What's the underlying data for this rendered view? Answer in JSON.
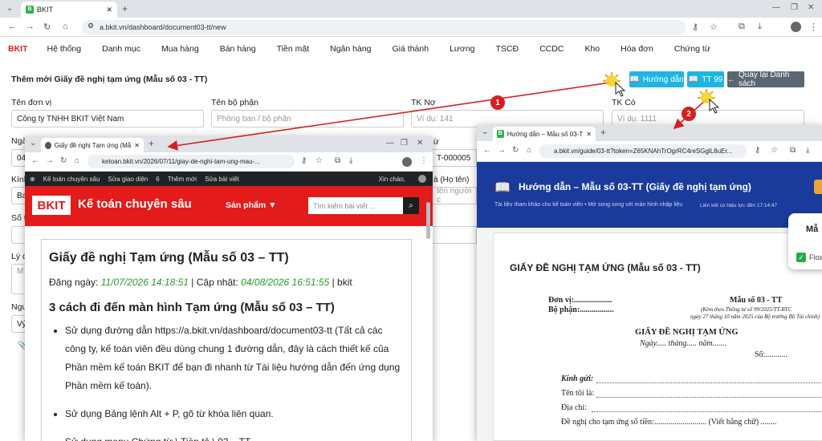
{
  "browser": {
    "tab_title": "BKIT",
    "url": "a.bkit.vn/dashboard/document03-tt/new"
  },
  "menu": {
    "logo": "BKIT",
    "items": [
      "Hệ thống",
      "Danh mục",
      "Mua hàng",
      "Bán hàng",
      "Tiền mặt",
      "Ngân hàng",
      "Giá thành",
      "Lương",
      "TSCĐ",
      "CCDC",
      "Kho",
      "Hóa đơn",
      "Chứng từ"
    ]
  },
  "page": {
    "title": "Thêm mới Giấy đề nghị tạm ứng (Mẫu số 03 - TT)",
    "help_btn": "Hướng dẫn",
    "tt_btn": "TT 99",
    "back_btn": "Quay lại Danh sách"
  },
  "form": {
    "don_vi_label": "Tên đơn vị",
    "don_vi_value": "Công ty TNHH BKIT Việt Nam",
    "bo_phan_label": "Tên bộ phận",
    "bo_phan_placeholder": "Phòng ban / bộ phận",
    "tk_no_label": "TK Nợ",
    "tk_no_placeholder": "Ví dụ: 141",
    "tk_co_label": "TK Có",
    "tk_co_placeholder": "Ví dụ: 1111",
    "partial_labels": [
      "Ngà",
      "Kính",
      "Số t",
      "Lý d",
      "Ngu"
    ],
    "partial_values": [
      "04",
      "Ba",
      "Vý"
    ],
    "partial_mid": [
      "T-000005",
      "ừ",
      "à (Họ tên)",
      "tên người c"
    ]
  },
  "blog": {
    "tab_title": "Giấy đề nghị Tạm ứng (Mẫu số",
    "url": "ketoan.bkit.vn/2026/07/11/giay-de-nghi-tam-ung-mau-...",
    "adminbar": [
      "Kế toán chuyên sâu",
      "Sửa giao diện",
      "6",
      "Thêm mới",
      "Sửa bài viết"
    ],
    "greeting": "Xin chào,",
    "brand": "BKIT",
    "site_name": "Kế toán chuyên sâu",
    "products": "Sản phẩm ▼",
    "search_placeholder": "Tìm kiếm bài viết ...",
    "heading": "Giấy đề nghị Tạm ứng (Mẫu số 03 – TT)",
    "posted_label": "Đăng ngày:",
    "posted": "11/07/2026 14:18:51",
    "sep1": "| Cập nhật:",
    "updated": "04/08/2026 16:51:55",
    "author": "| bkit",
    "subheading": "3 cách đi đến màn hình Tạm ứng (Mẫu số 03 – TT)",
    "steps": [
      "Sử dụng đường dẫn https://a.bkit.vn/dashboard/document03-tt (Tất cả các công ty, kế toán viên đều dùng chung 1 đường dẫn, đây là cách thiết kế của Phần mềm kế toán BKIT để bạn đi nhanh từ Tài liệu hướng dẫn đến ứng dụng Phần mềm kế toán).",
      "Sử dụng Bảng lệnh Alt + P, gõ từ khóa liên quan.",
      "Sử dụng menu Chứng từ \\ Tiền tệ \\ 03 – TT"
    ]
  },
  "guide": {
    "tab_title": "Hướng dẫn – Mẫu số 03-TT (G",
    "url": "a.bkit.vn/guide/03-tt?token=Z65KNAhTrOgrRC4reSGglL8uEr...",
    "header_title": "Hướng dẫn – Mẫu số 03-TT (Giấy đề nghị tạm ứng)",
    "header_sub": "Tài liệu tham khảo cho kế toán viên • Mở song song với màn hình nhập liệu",
    "validity": "Liên kết có hiệu lực đến 17:14:47",
    "side_title": "Mẫ",
    "side_checkbox": "Floa",
    "doc_title": "GIẤY ĐỀ NGHỊ TẠM ỨNG (Mẫu số 03 - TT)",
    "don_vi": "Đơn vị:...................",
    "bo_phan": "Bộ phận:.................",
    "form_no": "Mẫu số 03 - TT",
    "form_note1": "(Kèm theo Thông tư số 99/2025/TT-BTC",
    "form_note2": "ngày 27 tháng 10 năm 2025 của Bộ trưởng Bộ Tài chính)",
    "doc_heading": "GIẤY ĐỀ NGHỊ TẠM ỨNG",
    "date_line": "Ngày..... tháng..... năm.......",
    "so": "Số:...........",
    "kinh_gui": "Kính gửi:",
    "ten_toi": "Tên tôi là:",
    "dia_chi": "Địa chỉ:",
    "de_nghi": "Đề nghị cho tạm ứng số tiền:.......................... (Viết bằng chữ) ........"
  },
  "callouts": [
    "1",
    "2"
  ],
  "colors": {
    "accent": "#1eb4e6",
    "red": "#d42020",
    "blog_red": "#e31b1b",
    "guide_blue": "#1a3a9c",
    "gray_btn": "#5a6672"
  }
}
